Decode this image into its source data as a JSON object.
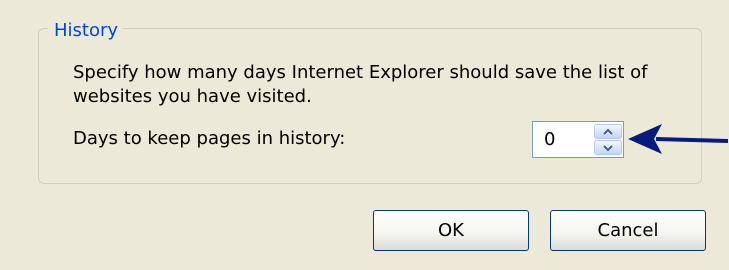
{
  "history": {
    "group_title": "History",
    "description": "Specify how many days Internet Explorer should save the list of websites you have visited.",
    "days_label": "Days to keep pages in history:",
    "days_value": "0",
    "days_spinner_icons": [
      "chevron-up-icon",
      "chevron-down-icon"
    ],
    "pointer_arrow_icon": "arrow-left-icon",
    "pointer_arrow_color": "#0a1a7a"
  },
  "buttons": {
    "ok_label": "OK",
    "cancel_label": "Cancel"
  },
  "colors": {
    "dialog_background": "#ece9d8",
    "group_title": "#0046d5",
    "group_border": "#d0d0bf",
    "button_border": "#003c74"
  }
}
